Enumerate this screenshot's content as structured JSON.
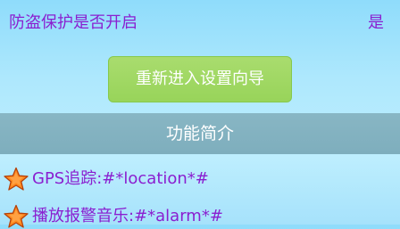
{
  "protection": {
    "label": "防盗保护是否开启",
    "value": "是"
  },
  "wizard": {
    "button_label": "重新进入设置向导"
  },
  "features": {
    "title": "功能简介",
    "items": [
      {
        "text": "GPS追踪:#*location*#",
        "icon": "star-icon"
      },
      {
        "text": "播放报警音乐:#*alarm*#",
        "icon": "star-icon"
      }
    ]
  },
  "colors": {
    "text_accent": "#8a1fd0",
    "button_green": "#a9dc6e",
    "section_bar": "#88b6c4",
    "star_orange": "#ff8a1f"
  }
}
